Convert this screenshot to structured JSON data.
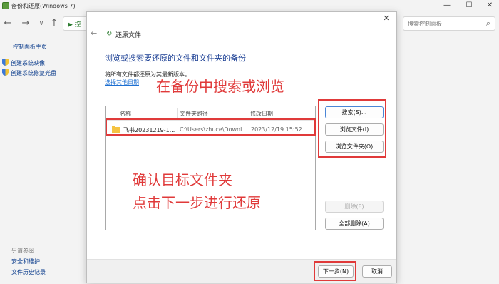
{
  "window": {
    "title": "备份和还原(Windows 7)",
    "minimize_glyph": "—",
    "maximize_glyph": "☐",
    "close_glyph": "✕"
  },
  "nav": {
    "back_glyph": "←",
    "forward_glyph": "→",
    "dropdown_glyph": "∨",
    "up_glyph": "↑",
    "address_glyph": "▶ 控"
  },
  "search": {
    "placeholder": "搜索控制面板",
    "icon_glyph": "⌕"
  },
  "sidebar": {
    "home": "控制面板主页",
    "items": [
      "创建系统映像",
      "创建系统修复光盘"
    ],
    "see_also": "另请参阅",
    "links": [
      "安全和维护",
      "文件历史记录"
    ]
  },
  "dialog": {
    "close_glyph": "✕",
    "back_glyph": "←",
    "icon_glyph": "↻",
    "title": "还原文件",
    "heading": "浏览或搜索要还原的文件和文件夹的备份",
    "description": "将所有文件都还原为其最新版本。",
    "other_date_link": "选择其他日期",
    "columns": [
      "名称",
      "文件夹路径",
      "修改日期"
    ],
    "rows": [
      {
        "name": "飞书20231219-1...",
        "path": "C:\\Users\\zhuce\\Downl...",
        "date": "2023/12/19 15:52"
      }
    ],
    "buttons": {
      "search": "搜索(S)...",
      "browse_files": "浏览文件(I)",
      "browse_folders": "浏览文件夹(O)",
      "remove": "删除(E)",
      "remove_all": "全部删除(A)",
      "next": "下一步(N)",
      "cancel": "取消"
    }
  },
  "annotations": {
    "top": "在备份中搜索或浏览",
    "line1": "确认目标文件夹",
    "line2": "点击下一步进行还原",
    "color": "#e03a3a"
  }
}
